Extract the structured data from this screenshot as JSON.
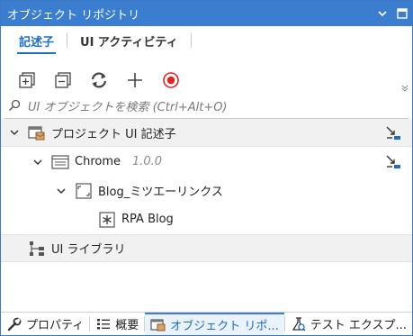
{
  "titlebar": {
    "title": "オブジェクト リポジトリ"
  },
  "tabs": [
    {
      "label": "記述子",
      "active": true
    },
    {
      "label": "UI アクティビティ",
      "active": false
    }
  ],
  "toolbar": {
    "icons": [
      "expand-all-icon",
      "collapse-all-icon",
      "refresh-icon",
      "add-icon",
      "record-icon"
    ]
  },
  "search": {
    "placeholder": "UI オブジェクトを検索 (Ctrl+Alt+O)"
  },
  "tree": {
    "project": {
      "label": "プロジェクト UI 記述子"
    },
    "app": {
      "label": "Chrome",
      "version": "1.0.0"
    },
    "screen": {
      "label": "Blog_ミツエーリンクス"
    },
    "element": {
      "label": "RPA Blog"
    },
    "library": {
      "label": "UI ライブラリ"
    }
  },
  "bottom_tabs": [
    {
      "label": "プロパティ",
      "active": false
    },
    {
      "label": "概要",
      "active": false
    },
    {
      "label": "オブジェクト リポ...",
      "active": true
    },
    {
      "label": "テスト エクスプ...",
      "active": false
    }
  ],
  "colors": {
    "accent": "#3b7ed0",
    "record": "#e02424"
  }
}
